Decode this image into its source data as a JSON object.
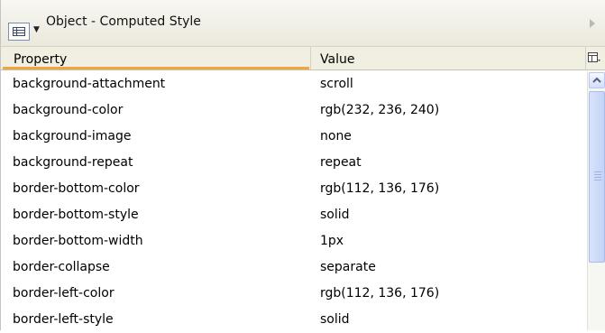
{
  "window": {
    "title": "Object - Computed Style"
  },
  "icons": {
    "view": "grid-view-icon",
    "dropdown": "dropdown-arrow-icon",
    "chevron": "chevron-right-icon",
    "column_chooser": "column-chooser-icon",
    "scroll_up": "scroll-up-arrow-icon"
  },
  "columns": {
    "property": "Property",
    "value": "Value"
  },
  "colors": {
    "sort_indicator": "#f0a541",
    "scroll_thumb": "#c3d3f6"
  },
  "rows": [
    {
      "property": "background-attachment",
      "value": "scroll"
    },
    {
      "property": "background-color",
      "value": "rgb(232, 236, 240)"
    },
    {
      "property": "background-image",
      "value": "none"
    },
    {
      "property": "background-repeat",
      "value": "repeat"
    },
    {
      "property": "border-bottom-color",
      "value": "rgb(112, 136, 176)"
    },
    {
      "property": "border-bottom-style",
      "value": "solid"
    },
    {
      "property": "border-bottom-width",
      "value": "1px"
    },
    {
      "property": "border-collapse",
      "value": "separate"
    },
    {
      "property": "border-left-color",
      "value": "rgb(112, 136, 176)"
    },
    {
      "property": "border-left-style",
      "value": "solid"
    }
  ]
}
